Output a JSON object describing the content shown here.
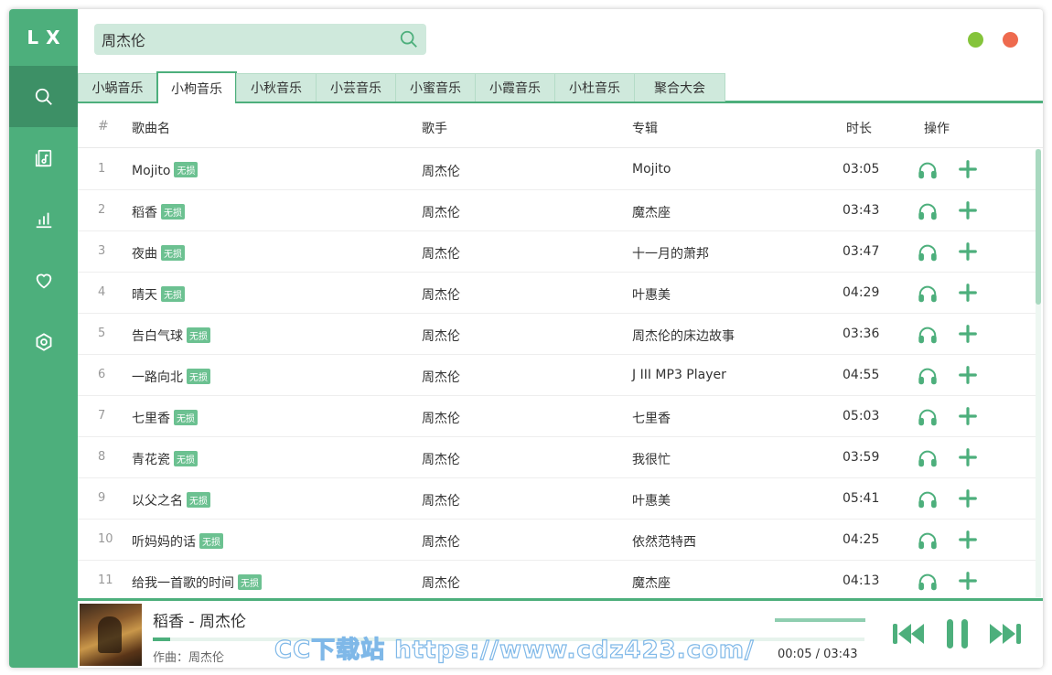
{
  "app": {
    "logo": "LX"
  },
  "sidebar": {
    "items": [
      {
        "icon": "search-icon",
        "active": true
      },
      {
        "icon": "music-file-icon",
        "active": false
      },
      {
        "icon": "bar-chart-icon",
        "active": false
      },
      {
        "icon": "heart-icon",
        "active": false
      },
      {
        "icon": "settings-hex-icon",
        "active": false
      }
    ]
  },
  "search": {
    "value": "周杰伦"
  },
  "colors": {
    "accent": "#4daf7c",
    "tab_bg": "#cfe9dc",
    "badge": "#6cc191",
    "minimize": "#85c43b",
    "close": "#ee6a4e"
  },
  "tabs": [
    {
      "label": "小蜗音乐",
      "active": false
    },
    {
      "label": "小枸音乐",
      "active": true
    },
    {
      "label": "小秋音乐",
      "active": false
    },
    {
      "label": "小芸音乐",
      "active": false
    },
    {
      "label": "小蜜音乐",
      "active": false
    },
    {
      "label": "小霞音乐",
      "active": false
    },
    {
      "label": "小杜音乐",
      "active": false
    },
    {
      "label": "聚合大会",
      "active": false
    }
  ],
  "table": {
    "headers": {
      "num": "#",
      "name": "歌曲名",
      "singer": "歌手",
      "album": "专辑",
      "duration": "时长",
      "ops": "操作"
    },
    "badge_label": "无损",
    "rows": [
      {
        "num": "1",
        "name": "Mojito",
        "singer": "周杰伦",
        "album": "Mojito",
        "duration": "03:05"
      },
      {
        "num": "2",
        "name": "稻香",
        "singer": "周杰伦",
        "album": "魔杰座",
        "duration": "03:43"
      },
      {
        "num": "3",
        "name": "夜曲",
        "singer": "周杰伦",
        "album": "十一月的萧邦",
        "duration": "03:47"
      },
      {
        "num": "4",
        "name": "晴天",
        "singer": "周杰伦",
        "album": "叶惠美",
        "duration": "04:29"
      },
      {
        "num": "5",
        "name": "告白气球",
        "singer": "周杰伦",
        "album": "周杰伦的床边故事",
        "duration": "03:36"
      },
      {
        "num": "6",
        "name": "一路向北",
        "singer": "周杰伦",
        "album": "J III MP3 Player",
        "duration": "04:55"
      },
      {
        "num": "7",
        "name": "七里香",
        "singer": "周杰伦",
        "album": "七里香",
        "duration": "05:03"
      },
      {
        "num": "8",
        "name": "青花瓷",
        "singer": "周杰伦",
        "album": "我很忙",
        "duration": "03:59"
      },
      {
        "num": "9",
        "name": "以父之名",
        "singer": "周杰伦",
        "album": "叶惠美",
        "duration": "05:41"
      },
      {
        "num": "10",
        "name": "听妈妈的话",
        "singer": "周杰伦",
        "album": "依然范特西",
        "duration": "04:25"
      },
      {
        "num": "11",
        "name": "给我一首歌的时间",
        "singer": "周杰伦",
        "album": "魔杰座",
        "duration": "04:13"
      }
    ]
  },
  "player": {
    "title": "稻香 - 周杰伦",
    "author": "作曲：周杰伦",
    "time": "00:05 / 03:43",
    "progress": 0.024,
    "volume": 1.0
  },
  "watermark": "CC下载站 https://www.cdz423.com/"
}
